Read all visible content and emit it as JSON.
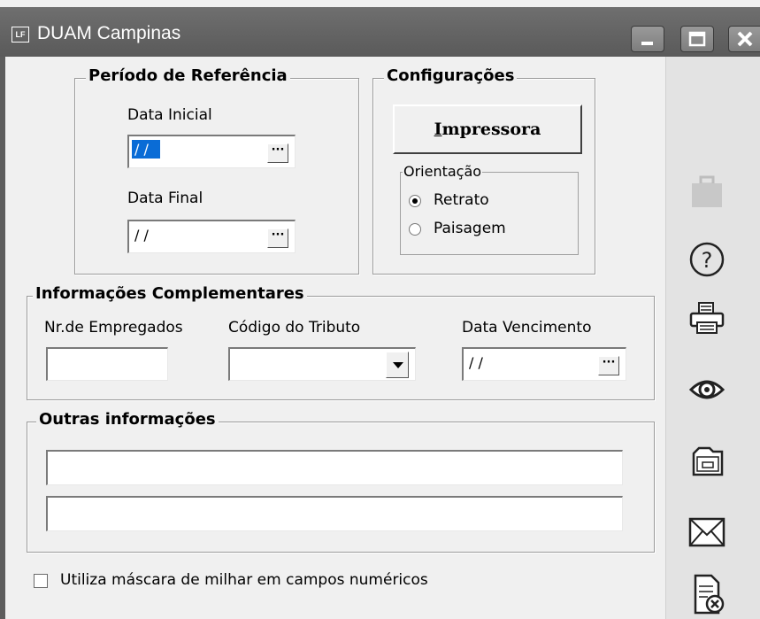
{
  "window": {
    "title": "DUAM Campinas",
    "logo_text": "LF"
  },
  "periodo": {
    "legend": "Período de Referência",
    "data_inicial_label": "Data Inicial",
    "data_inicial_value": "/ /",
    "data_final_label": "Data Final",
    "data_final_value": "/ /",
    "picker_glyph": "···"
  },
  "config": {
    "legend": "Configurações",
    "printer_button_underlined": "I",
    "printer_button_rest": "mpressora",
    "orientacao_legend": "Orientação",
    "options": [
      {
        "label": "Retrato",
        "selected": true
      },
      {
        "label": "Paisagem",
        "selected": false
      }
    ]
  },
  "info": {
    "legend": "Informações Complementares",
    "nr_empregados_label": "Nr.de Empregados",
    "nr_empregados_value": "",
    "codigo_tributo_label": "Código do Tributo",
    "codigo_tributo_value": "",
    "data_vencimento_label": "Data Vencimento",
    "data_vencimento_value": "/ /"
  },
  "outras": {
    "legend": "Outras informações",
    "line1": "",
    "line2": ""
  },
  "mascara": {
    "label": "Utiliza máscara de milhar em campos numéricos",
    "checked": false
  },
  "sidebar": [
    "briefcase-icon",
    "help-icon",
    "printer-icon",
    "preview-eye-icon",
    "folder-icon",
    "mail-icon",
    "close-document-icon"
  ]
}
